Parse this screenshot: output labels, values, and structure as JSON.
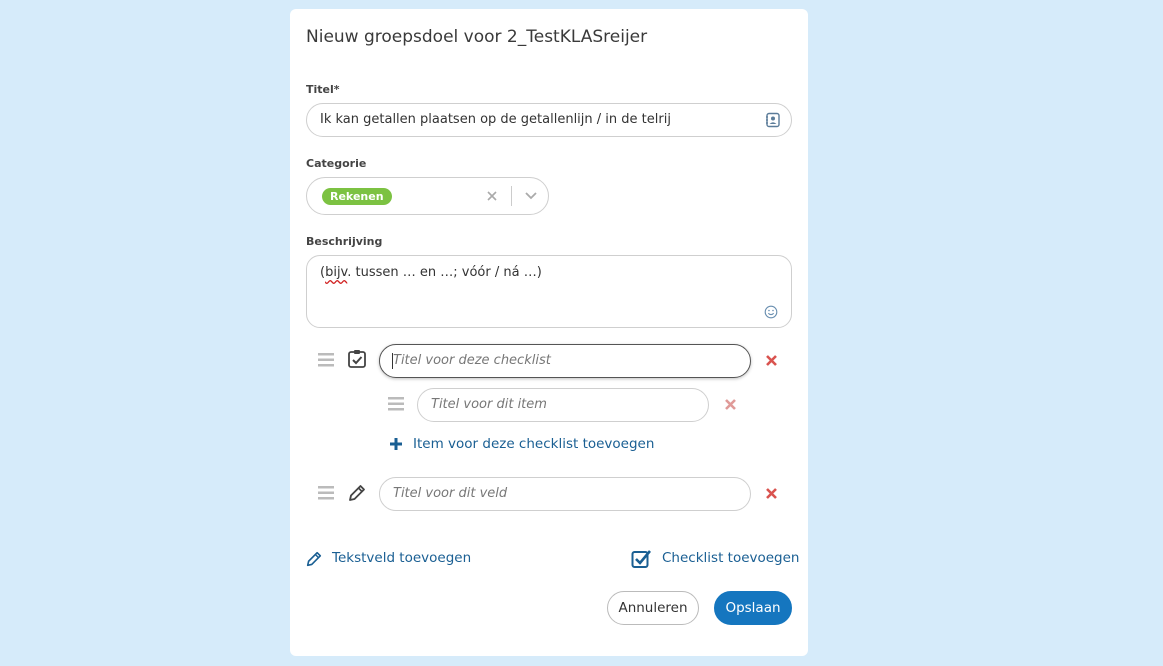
{
  "dialog": {
    "title": "Nieuw groepsdoel voor 2_TestKLASreijer"
  },
  "titel": {
    "label": "Titel*",
    "value": "Ik kan getallen  plaatsen op de getallenlijn / in de telrij"
  },
  "categorie": {
    "label": "Categorie",
    "selected": "Rekenen",
    "badge_color": "#7cc242"
  },
  "beschrijving": {
    "label": "Beschrijving",
    "value_prefix": "(",
    "value_misspelled": "bijv",
    "value_rest": ". tussen … en …; vóór / ná …)"
  },
  "checklist": {
    "title_placeholder": "Titel voor deze checklist",
    "item_placeholder": "Titel voor dit item",
    "add_item_label": "Item voor deze checklist toevoegen"
  },
  "textfield": {
    "placeholder": "Titel voor dit veld"
  },
  "actions": {
    "add_textfield": "Tekstveld toevoegen",
    "add_checklist": "Checklist toevoegen",
    "cancel": "Annuleren",
    "save": "Opslaan"
  },
  "colors": {
    "primary": "#1576bf",
    "link": "#1a5f93",
    "delete": "#d9534f",
    "background": "#d6ebfa"
  },
  "icons": [
    "contact-card-icon",
    "clear-icon",
    "chevron-down-icon",
    "emoji-icon",
    "drag-handle-icon",
    "checklist-icon",
    "delete-icon",
    "plus-icon",
    "pencil-icon",
    "checkbox-icon"
  ]
}
